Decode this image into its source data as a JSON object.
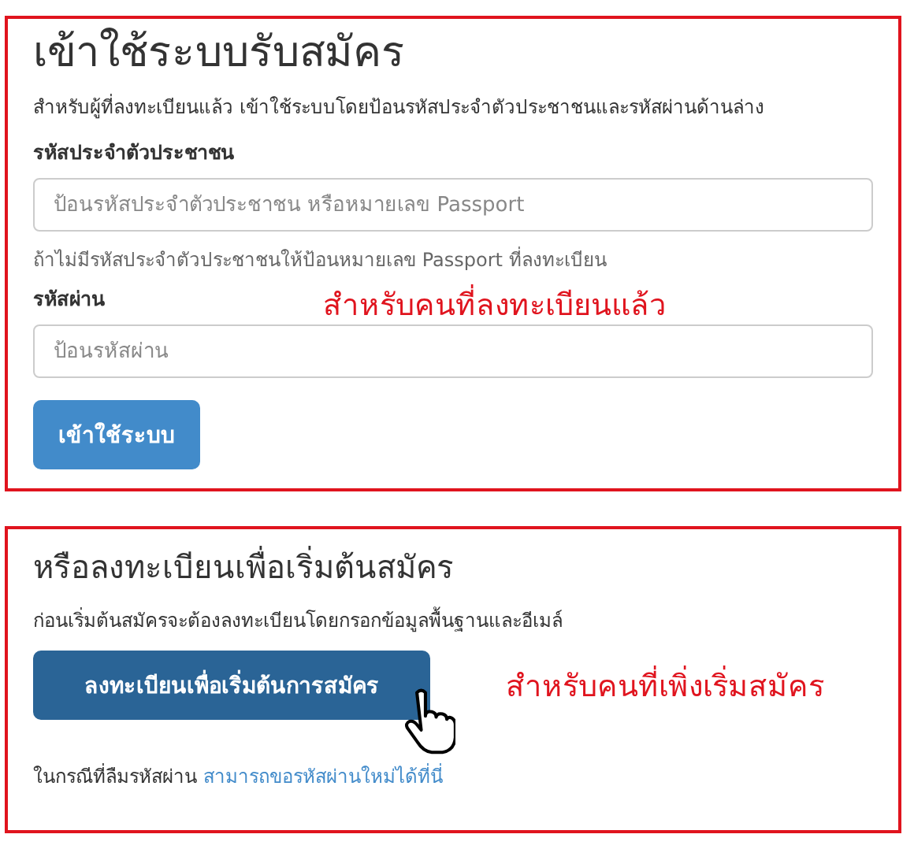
{
  "login": {
    "title": "เข้าใช้ระบบรับสมัคร",
    "description": "สำหรับผู้ที่ลงทะเบียนแล้ว เข้าใช้ระบบโดยป้อนรหัสประจำตัวประชาชนและรหัสผ่านด้านล่าง",
    "fields": [
      {
        "label": "รหัสประจำตัวประชาชน",
        "placeholder": "ป้อนรหัสประจำตัวประชาชน หรือหมายเลข Passport",
        "help": "ถ้าไม่มีรหัสประจำตัวประชาชนให้ป้อนหมายเลข Passport ที่ลงทะเบียน"
      },
      {
        "label": "รหัสผ่าน",
        "placeholder": "ป้อนรหัสผ่าน"
      }
    ],
    "button": "เข้าใช้ระบบ",
    "annotation": "สำหรับคนที่ลงทะเบียนแล้ว"
  },
  "register": {
    "title": "หรือลงทะเบียนเพื่อเริ่มต้นสมัคร",
    "description": "ก่อนเริ่มต้นสมัครจะต้องลงทะเบียนโดยกรอกข้อมูลพื้นฐานและอีเมล์",
    "button": "ลงทะเบียนเพื่อเริ่มต้นการสมัคร",
    "annotation": "สำหรับคนที่เพิ่งเริ่มสมัคร",
    "forgot_text": "ในกรณีที่ลืมรหัสผ่าน",
    "forgot_link": "สามารถขอรหัสผ่านใหม่ได้ที่นี่"
  }
}
